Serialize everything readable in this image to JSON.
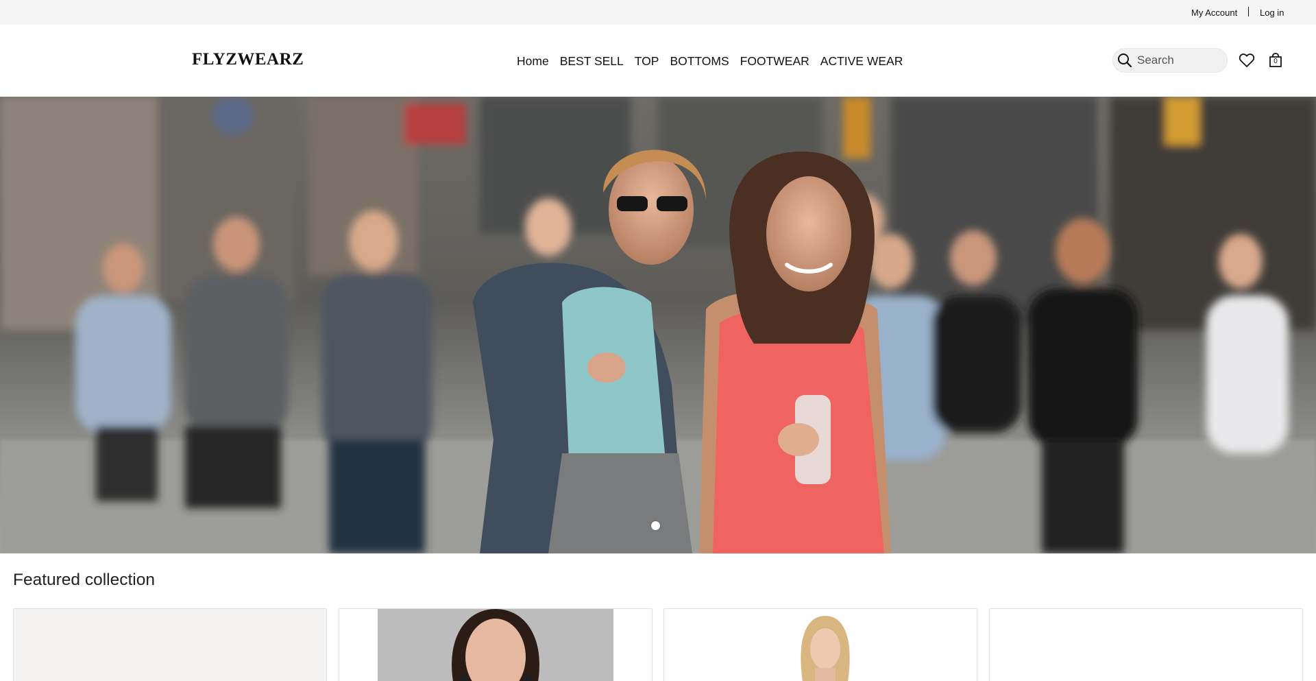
{
  "utility": {
    "my_account": "My Account",
    "log_in": "Log in"
  },
  "header": {
    "logo": "FLYZWEARZ",
    "nav": [
      "Home",
      "BEST SELL",
      "TOP",
      "BOTTOMS",
      "FOOTWEAR",
      "ACTIVE WEAR"
    ],
    "search_placeholder": "Search",
    "cart_count": "0",
    "icons": [
      "search-icon",
      "heart-icon",
      "shopping-bag-icon"
    ]
  },
  "hero": {
    "slides_total": 1,
    "active_slide": 1
  },
  "featured": {
    "title": "Featured collection"
  },
  "colors": {
    "utility_bg": "#f5f5f5",
    "search_bg": "#f1f1f1",
    "text": "#111111"
  }
}
